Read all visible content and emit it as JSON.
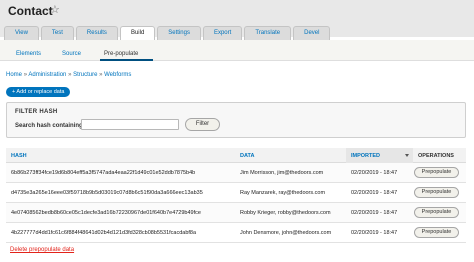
{
  "page": {
    "title": "Contact"
  },
  "tabs": [
    {
      "label": "View"
    },
    {
      "label": "Test"
    },
    {
      "label": "Results"
    },
    {
      "label": "Build"
    },
    {
      "label": "Settings"
    },
    {
      "label": "Export"
    },
    {
      "label": "Translate"
    },
    {
      "label": "Devel"
    }
  ],
  "subtabs": [
    {
      "label": "Elements"
    },
    {
      "label": "Source"
    },
    {
      "label": "Pre-populate"
    }
  ],
  "breadcrumb": {
    "items": [
      "Home",
      "Administration",
      "Structure",
      "Webforms"
    ],
    "separator": "»"
  },
  "add_button": {
    "label": "+ Add or replace data"
  },
  "filter": {
    "title": "FILTER HASH",
    "label": "Search hash containing:",
    "input_value": "",
    "button_label": "Filter"
  },
  "table": {
    "columns": {
      "hash": "HASH",
      "data": "DATA",
      "imported": "IMPORTED",
      "operations": "OPERATIONS"
    },
    "rows": [
      {
        "hash": "6b86b273ff34fce19d6b804eff5a3f5747ada4eaa22f1d49c01e52ddb7875b4b",
        "data": "Jim Morrisson, jim@thedoors.com",
        "imported": "02/20/2019 - 18:47",
        "op": "Prepopulate"
      },
      {
        "hash": "d4735e3a265e16eee03f59718b9b5d03019c07d8b6c51f90da3a666eec13ab35",
        "data": "Ray Manzarek, ray@thedoors.com",
        "imported": "02/20/2019 - 18:47",
        "op": "Prepopulate"
      },
      {
        "hash": "4e07408562bedb8b60ce05c1decfe3ad16b72230967de01f640b7e4729b49fce",
        "data": "Robby Krieger, robby@thedoors.com",
        "imported": "02/20/2019 - 18:47",
        "op": "Prepopulate"
      },
      {
        "hash": "4b227777d4dd1fc61c6f884f48641d02b4d121d3fd328cb08b5531fcacdabf8a",
        "data": "John Densmore, john@thedoors.com",
        "imported": "02/20/2019 - 18:47",
        "op": "Prepopulate"
      }
    ]
  },
  "delete_link": {
    "label": "Delete prepopulate data"
  }
}
